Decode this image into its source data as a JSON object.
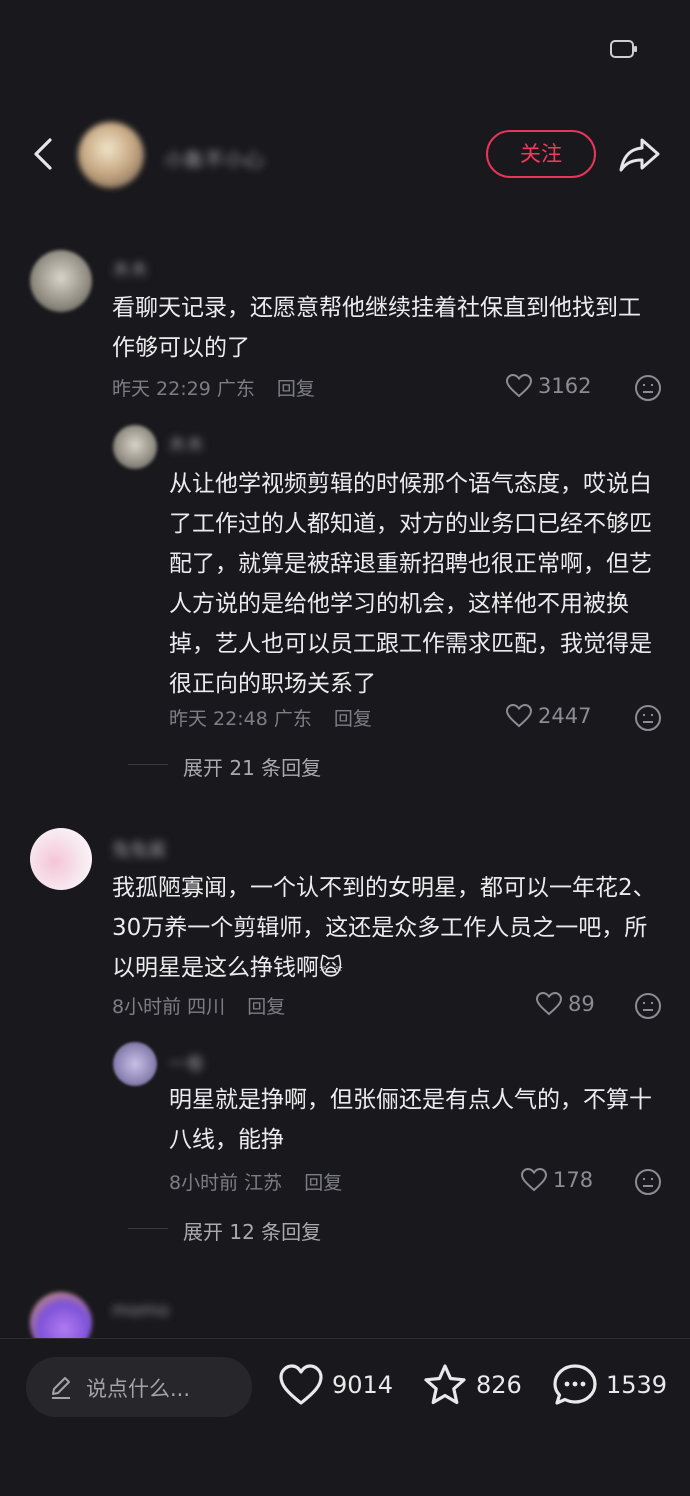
{
  "header": {
    "username": "小象不小心",
    "follow_label": "关注"
  },
  "comments": [
    {
      "user": "木木",
      "text": "看聊天记录，还愿意帮他继续挂着社保直到他找到工作够可以的了",
      "time": "昨天 22:29",
      "location": "广东",
      "reply_label": "回复",
      "likes": "3162",
      "reply": {
        "user": "木木",
        "text": "从让他学视频剪辑的时候那个语气态度，哎说白了工作过的人都知道，对方的业务口已经不够匹配了，就算是被辞退重新招聘也很正常啊，但艺人方说的是给他学习的机会，这样他不用被换掉，艺人也可以员工跟工作需求匹配，我觉得是很正向的职场关系了",
        "time": "昨天 22:48",
        "location": "广东",
        "reply_label": "回复",
        "likes": "2447"
      },
      "expand_label": "展开 21 条回复"
    },
    {
      "user": "兔兔酱",
      "text": "我孤陋寡闻，一个认不到的女明星，都可以一年花2、30万养一个剪辑师，这还是众多工作人员之一吧，所以明星是这么挣钱啊🙀",
      "time": "8小时前",
      "location": "四川",
      "reply_label": "回复",
      "likes": "89",
      "reply": {
        "user": "一卷",
        "text": "明星就是挣啊，但张俪还是有点人气的，不算十八线，能挣",
        "time": "8小时前",
        "location": "江苏",
        "reply_label": "回复",
        "likes": "178"
      },
      "expand_label": "展开 12 条回复"
    },
    {
      "user": "momo"
    }
  ],
  "bottom_bar": {
    "placeholder": "说点什么...",
    "likes": "9014",
    "favorites": "826",
    "comments": "1539"
  },
  "colors": {
    "background": "#19191d",
    "accent": "#f23a5f"
  }
}
